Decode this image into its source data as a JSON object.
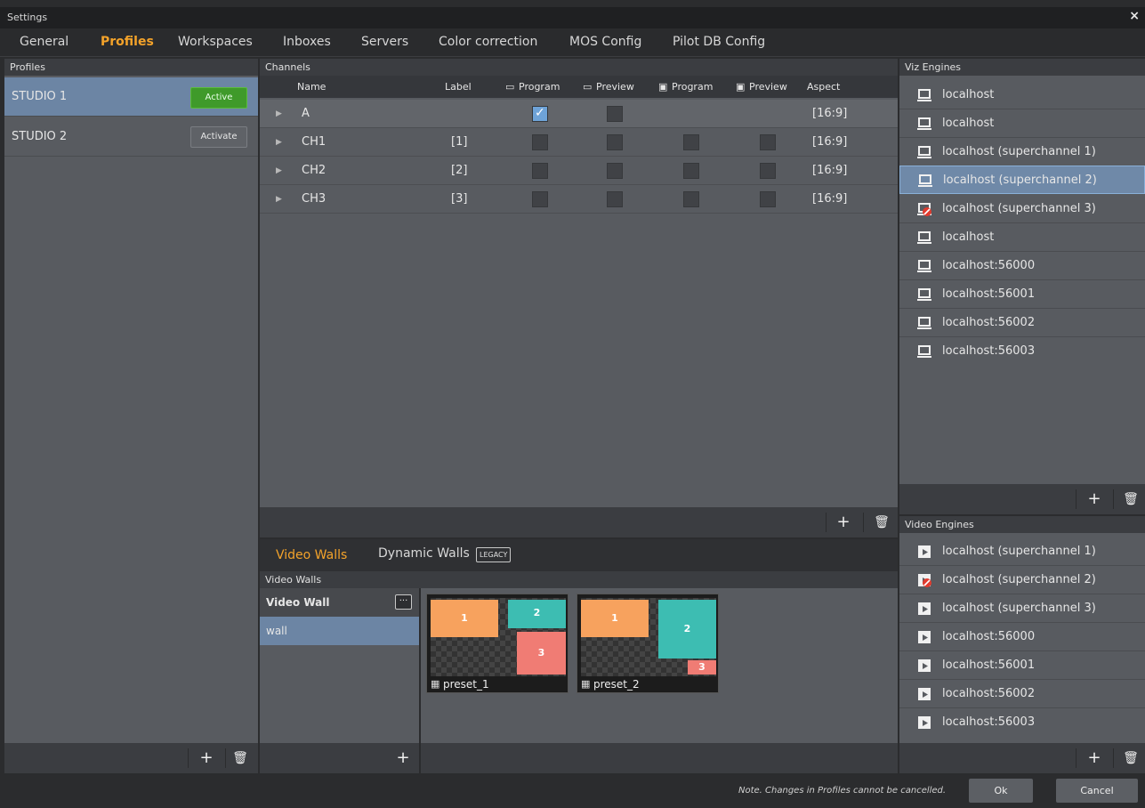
{
  "window": {
    "title": "Settings",
    "close": "×"
  },
  "tabs": [
    "General",
    "Profiles",
    "Workspaces",
    "Inboxes",
    "Servers",
    "Color correction",
    "MOS Config",
    "Pilot DB Config"
  ],
  "profiles": {
    "header": "Profiles",
    "items": [
      {
        "name": "STUDIO 1",
        "button": "Active"
      },
      {
        "name": "STUDIO 2",
        "button": "Activate"
      }
    ]
  },
  "channels": {
    "header": "Channels",
    "columns": [
      "Name",
      "Label",
      "Program",
      "Preview",
      "Program",
      "Preview",
      "Aspect"
    ],
    "rows": [
      {
        "name": "A",
        "label": "",
        "aspect": "[16:9]"
      },
      {
        "name": "CH1",
        "label": "[1]",
        "aspect": "[16:9]"
      },
      {
        "name": "CH2",
        "label": "[2]",
        "aspect": "[16:9]"
      },
      {
        "name": "CH3",
        "label": "[3]",
        "aspect": "[16:9]"
      }
    ]
  },
  "walls": {
    "tabs": [
      "Video Walls",
      "Dynamic Walls"
    ],
    "legacy_badge": "LEGACY",
    "subheader": "Video Walls",
    "list_title": "Video Wall",
    "list_items": [
      "wall"
    ],
    "more": "···",
    "presets": [
      {
        "name": "preset_1",
        "blocks": [
          "1",
          "2",
          "3"
        ]
      },
      {
        "name": "preset_2",
        "blocks": [
          "1",
          "2",
          "3"
        ]
      }
    ]
  },
  "viz_engines": {
    "header": "Viz Engines",
    "items": [
      "localhost",
      "localhost",
      "localhost (superchannel 1)",
      "localhost (superchannel 2)",
      "localhost (superchannel 3)",
      "localhost",
      "localhost:56000",
      "localhost:56001",
      "localhost:56002",
      "localhost:56003"
    ]
  },
  "video_engines": {
    "header": "Video Engines",
    "items": [
      "localhost (superchannel 1)",
      "localhost (superchannel 2)",
      "localhost (superchannel 3)",
      "localhost:56000",
      "localhost:56001",
      "localhost:56002",
      "localhost:56003"
    ]
  },
  "footer": {
    "note": "Note. Changes in Profiles cannot be cancelled.",
    "ok": "Ok",
    "cancel": "Cancel"
  },
  "icons": {
    "add": "+",
    "trash": "🗑",
    "expand": "▶"
  },
  "colors": {
    "accent": "#f4a32a",
    "active_green": "#3f9a2a",
    "selection": "#6c85a4",
    "block1": "#f7a25e",
    "block2": "#3dbdb2",
    "block3": "#f07c74"
  }
}
